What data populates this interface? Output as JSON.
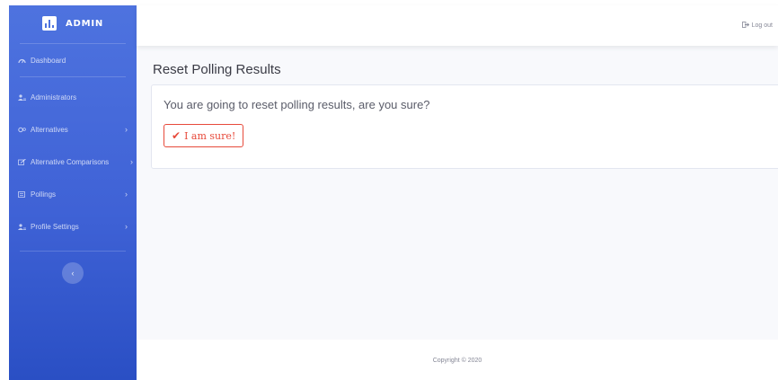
{
  "sidebar": {
    "brand": "ADMIN",
    "items": [
      {
        "label": "Dashboard",
        "icon": "gauge-icon",
        "has_chevron": false
      },
      {
        "label": "Administrators",
        "icon": "users-icon",
        "has_chevron": false
      },
      {
        "label": "Alternatives",
        "icon": "cogs-icon",
        "has_chevron": true
      },
      {
        "label": "Alternative Comparisons",
        "icon": "edit-icon",
        "has_chevron": true
      },
      {
        "label": "Pollings",
        "icon": "list-icon",
        "has_chevron": true
      },
      {
        "label": "Profile Settings",
        "icon": "user-cog-icon",
        "has_chevron": true
      }
    ],
    "chevron": "›",
    "collapse_glyph": "‹"
  },
  "topbar": {
    "logout_label": "Log out",
    "logout_icon": "sign-out-icon"
  },
  "main": {
    "title": "Reset Polling Results",
    "message": "You are going to reset polling results, are you sure?",
    "confirm_label": "I am sure!",
    "confirm_icon": "check-icon"
  },
  "footer": {
    "copyright": "Copyright © 2020"
  },
  "colors": {
    "sidebar_primary": "#4e73df",
    "danger": "#e74a3b",
    "background": "#f8f9fc"
  }
}
